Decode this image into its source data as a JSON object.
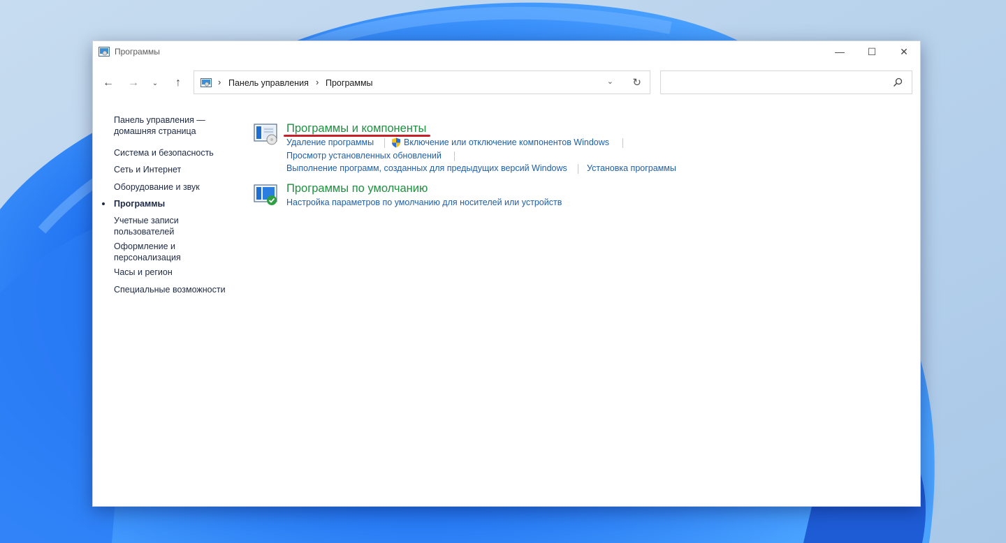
{
  "window": {
    "title": "Программы"
  },
  "caption": {
    "minimize": "—",
    "maximize": "☐",
    "close": "✕"
  },
  "nav": {
    "back": "←",
    "forward": "→",
    "recent": "⌄",
    "up": "↑"
  },
  "address": {
    "breadcrumbs": [
      "Панель управления",
      "Программы"
    ],
    "separator": "›",
    "dropdown": "⌄",
    "refresh": "↻"
  },
  "search": {
    "value": "",
    "placeholder": ""
  },
  "sidebar": {
    "items": [
      {
        "label_line1": "Панель управления —",
        "label_line2": "домашняя страница"
      },
      {
        "label_line1": "Система и безопасность"
      },
      {
        "label_line1": "Сеть и Интернет"
      },
      {
        "label_line1": "Оборудование и звук"
      },
      {
        "label_line1": "Программы",
        "current": true
      },
      {
        "label_line1": "Учетные записи",
        "label_line2": "пользователей"
      },
      {
        "label_line1": "Оформление и",
        "label_line2": "персонализация"
      },
      {
        "label_line1": "Часы и регион"
      },
      {
        "label_line1": "Специальные возможности"
      }
    ]
  },
  "categories": [
    {
      "title": "Программы и компоненты",
      "tasks": [
        "Удаление программы",
        "Включение или отключение компонентов Windows",
        "Просмотр установленных обновлений",
        "Выполнение программ, созданных для предыдущих версий Windows",
        "Установка программы"
      ]
    },
    {
      "title": "Программы по умолчанию",
      "tasks": [
        "Настройка параметров по умолчанию для носителей или устройств"
      ]
    }
  ],
  "colors": {
    "category_title": "#1e8f3f",
    "task_link": "#1f5fa8",
    "highlight_underline": "#c8202b"
  }
}
